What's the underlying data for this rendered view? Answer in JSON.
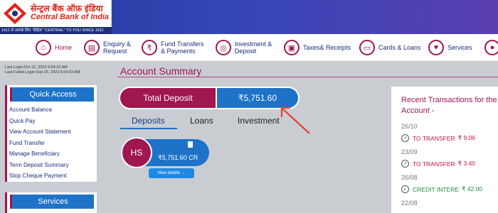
{
  "header": {
    "logo_hindi": "सेन्ट्रल बैंक ऑफ़ इंडिया",
    "logo_english": "Central Bank of India",
    "logo_tagline": "1911 से आपके लिए \"केंद्रित\" \"CENTRAL\" TO YOU SINCE 1911"
  },
  "nav": {
    "items": [
      {
        "label": "Home",
        "icon": "home-icon"
      },
      {
        "label": "Enquiry & Request",
        "icon": "document-icon"
      },
      {
        "label": "Fund Transfers & Payments",
        "icon": "rupee-transfer-icon"
      },
      {
        "label": "Investment & Deposit",
        "icon": "investment-icon"
      },
      {
        "label": "Taxes& Receipts",
        "icon": "wallet-icon"
      },
      {
        "label": "Cards & Loans",
        "icon": "card-icon"
      },
      {
        "label": "Services",
        "icon": "heart-check-icon"
      },
      {
        "label": "",
        "icon": "user-icon"
      }
    ]
  },
  "login_info": {
    "last_login": "Last Login:Oct 12, 2023 9:54:32 AM",
    "last_failed": "Last Failed Login:Sep 26, 2023 6:59:03 AM"
  },
  "quick_access": {
    "title": "Quick Access",
    "items": [
      "Account Balance",
      "Quick Pay",
      "View Account Statement",
      "Fund Transfer",
      "Manage Beneficiary",
      "Term Deposit Summary",
      "Stop Cheque Payment"
    ]
  },
  "services_panel": {
    "title": "Services"
  },
  "summary": {
    "title": "Account Summary",
    "total_label": "Total Deposit",
    "total_value": "₹5,751.60",
    "tabs": [
      "Deposits",
      "Loans",
      "Investment"
    ],
    "account": {
      "initials": "HS",
      "amount": "₹5,751.60 CR",
      "view_details": "View details  →"
    }
  },
  "recent": {
    "title": "Recent Transactions for the Account -",
    "transactions": [
      {
        "date": "26/10",
        "name": "TO TRANSFER",
        "amount": "₹  9.06",
        "direction": "out"
      },
      {
        "date": "23/09",
        "name": "TO TRANSFER",
        "amount": "₹  3.40",
        "direction": "out"
      },
      {
        "date": "26/08",
        "name": "CREDIT INTERE",
        "amount": "₹  42.00",
        "direction": "in"
      },
      {
        "date": "22/08",
        "name": "",
        "amount": "",
        "direction": ""
      }
    ]
  },
  "colors": {
    "brand_maroon": "#a0164e",
    "brand_blue": "#1e73c8",
    "header_blue": "#1f3ca0"
  }
}
